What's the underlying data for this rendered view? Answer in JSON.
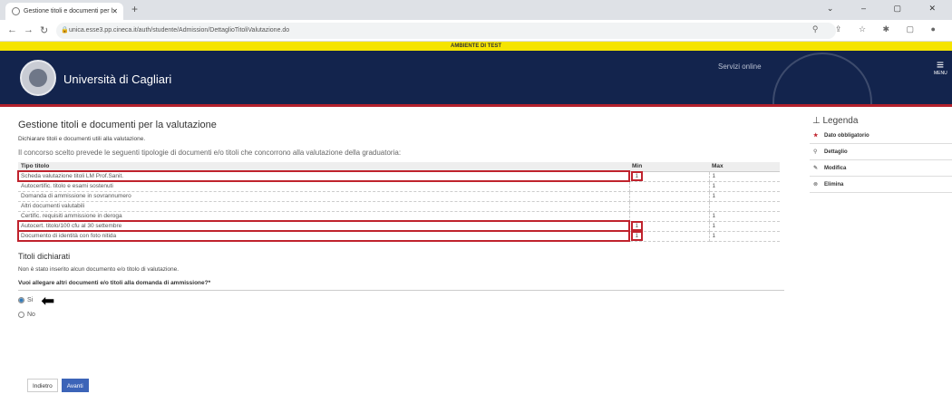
{
  "browser": {
    "tab_title": "Gestione titoli e documenti per l",
    "url": "unica.esse3.pp.cineca.it/auth/studente/Admission/DettaglioTitoliValutazione.do"
  },
  "test_banner": "AMBIENTE DI TEST",
  "header": {
    "university": "Università di Cagliari",
    "servizi": "Servizi online",
    "menu": "MENU"
  },
  "page": {
    "title": "Gestione titoli e documenti per la valutazione",
    "intro": "Dichiarare titoli e documenti utili alla valutazione.",
    "info": "Il concorso scelto prevede le seguenti tipologie di documenti e/o titoli che concorrono alla valutazione della graduatoria:",
    "table": {
      "headers": [
        "Tipo titolo",
        "Min",
        "Max"
      ],
      "rows": [
        {
          "tipo": "Scheda valutazione titoli LM Prof.Sanit.",
          "min": "1",
          "max": "1"
        },
        {
          "tipo": "Autocertific. titolo e esami sostenuti",
          "min": "",
          "max": "1"
        },
        {
          "tipo": "Domanda di ammissione in sovrannumero",
          "min": "",
          "max": "1"
        },
        {
          "tipo": "Altri documenti valutabili",
          "min": "",
          "max": ""
        },
        {
          "tipo": "Certific. requisiti ammissione in deroga",
          "min": "",
          "max": "1"
        },
        {
          "tipo": "Autocert. titolo/100 cfu al 30 settembre",
          "min": "1",
          "max": "1"
        },
        {
          "tipo": "Documento di identità con foto nitida",
          "min": "1",
          "max": "1"
        }
      ]
    },
    "declared_title": "Titoli dichiarati",
    "declared_text": "Non è stato inserito alcun documento e/o titolo di valutazione.",
    "question": "Vuoi allegare altri documenti e/o titoli alla domanda di ammissione?*",
    "options": [
      "Si",
      "No"
    ],
    "buttons": {
      "back": "Indietro",
      "next": "Avanti"
    }
  },
  "legend": {
    "title": "Legenda",
    "items": [
      {
        "icon": "star-icon",
        "label": "Dato obbligatorio"
      },
      {
        "icon": "magnifier-icon",
        "label": "Dettaglio"
      },
      {
        "icon": "edit-icon",
        "label": "Modifica"
      },
      {
        "icon": "delete-icon",
        "label": "Elimina"
      }
    ]
  }
}
